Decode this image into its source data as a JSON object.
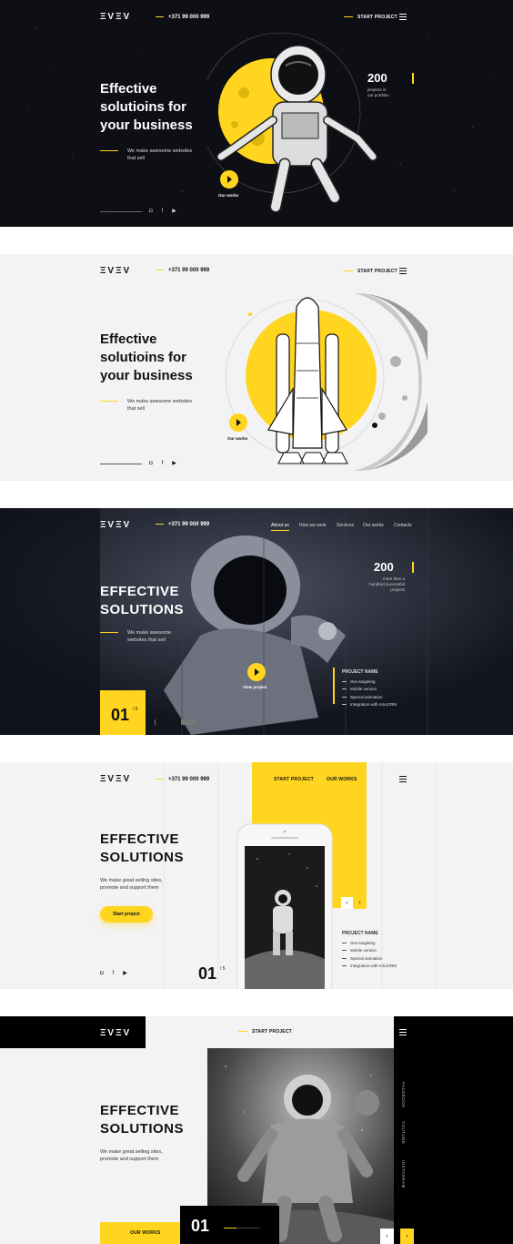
{
  "brand": {
    "logo": "ΞVΞV",
    "phone": "+371 99 000 999",
    "start_project": "START PROJECT"
  },
  "panel1": {
    "title_lines": [
      "Effective",
      "solutioins for",
      "your business"
    ],
    "subtitle_lines": [
      "We make awesome websites",
      "that sell"
    ],
    "count": "200",
    "count_sub_lines": [
      "projects in",
      "our portfolio"
    ],
    "our_works": "Our works",
    "social": [
      "instagram-icon",
      "facebook-icon",
      "youtube-icon"
    ]
  },
  "panel2": {
    "title_lines": [
      "Effective",
      "solutioins for",
      "your business"
    ],
    "subtitle_lines": [
      "We make awesome websites",
      "that sell"
    ],
    "our_works": "Our works"
  },
  "panel3": {
    "nav": [
      "About us",
      "How we work",
      "Services",
      "Our works",
      "Contacts"
    ],
    "title_lines": [
      "EFFECTIVE",
      "SOLUTIONS"
    ],
    "subtitle_lines": [
      "We make awesome",
      "websites that sell"
    ],
    "count": "200",
    "count_sub_lines": [
      "more than a",
      "hundred successful",
      "projects"
    ],
    "view_project": "View project",
    "project_title": "PROJECT NAME",
    "project_items": [
      "Geo-targeting",
      "Mobile version",
      "Special animation",
      "Integration with AmoCRM"
    ],
    "slide_num": "01",
    "slide_total": "/ 5"
  },
  "panel4": {
    "start_project": "START PROJECT",
    "our_works": "OUR WORKS",
    "title_lines": [
      "EFFECTIVE",
      "SOLUTIONS"
    ],
    "subtitle_lines": [
      "We make great selling sites,",
      "promote and support them"
    ],
    "button": "Start project",
    "slide_num": "01",
    "slide_total": "/ 5",
    "project_title": "PROJECT NAME",
    "project_items": [
      "Geo-targeting",
      "Mobile version",
      "Special animation",
      "Integration with AmoCRM"
    ]
  },
  "panel5": {
    "start_project": "START PROJECT",
    "title_lines": [
      "EFFECTIVE",
      "SOLUTIONS"
    ],
    "subtitle_lines": [
      "We make great selling sites,",
      "promote and support them"
    ],
    "our_works": "OUR WORKS",
    "slide_num": "01",
    "side_links": [
      "FACEBOOK",
      "YOUTUBE",
      "INSTAGRAM"
    ]
  },
  "colors": {
    "accent": "#ffd51f",
    "dark": "#0d0f14",
    "light": "#f3f3f5"
  }
}
